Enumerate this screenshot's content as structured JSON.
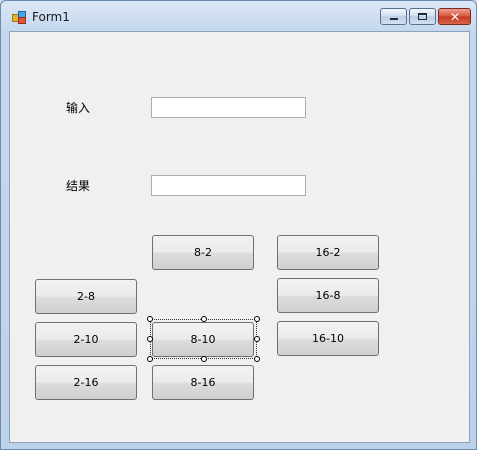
{
  "window": {
    "title": "Form1",
    "icon": "winforms-app-icon",
    "controls": {
      "minimize": "minimize-icon",
      "maximize": "maximize-icon",
      "close": "close-icon",
      "close_glyph": "✕"
    }
  },
  "form": {
    "input_label": "输入",
    "result_label": "结果",
    "input_value": "",
    "result_value": "",
    "buttons": {
      "b8_2": "8-2",
      "b16_2": "16-2",
      "b2_8": "2-8",
      "b16_8": "16-8",
      "b2_10": "2-10",
      "b8_10": "8-10",
      "b16_10": "16-10",
      "b2_16": "2-16",
      "b8_16": "8-16"
    },
    "selected_button": "8-10"
  }
}
